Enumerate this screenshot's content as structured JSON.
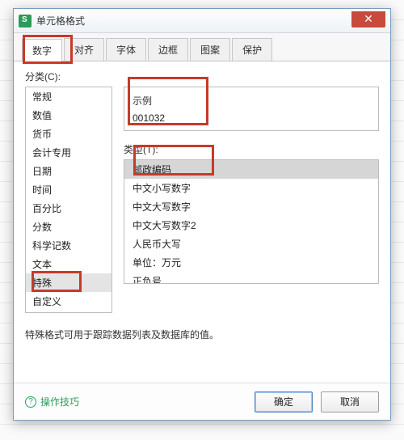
{
  "window": {
    "title": "单元格格式",
    "close_glyph": "✕"
  },
  "tabs": {
    "items": [
      "数字",
      "对齐",
      "字体",
      "边框",
      "图案",
      "保护"
    ],
    "active_index": 0
  },
  "category": {
    "label": "分类(C):",
    "items": [
      "常规",
      "数值",
      "货币",
      "会计专用",
      "日期",
      "时间",
      "百分比",
      "分数",
      "科学记数",
      "文本",
      "特殊",
      "自定义"
    ],
    "selected_index": 10
  },
  "example": {
    "label": "示例",
    "value": "001032"
  },
  "type": {
    "label": "类型(T):",
    "items": [
      "邮政编码",
      "中文小写数字",
      "中文大写数字",
      "中文大写数字2",
      "人民币大写",
      "单位：万元",
      "正负号"
    ],
    "selected_index": 0
  },
  "description": "特殊格式可用于跟踪数据列表及数据库的值。",
  "footer": {
    "tips_label": "操作技巧",
    "ok_label": "确定",
    "cancel_label": "取消"
  }
}
